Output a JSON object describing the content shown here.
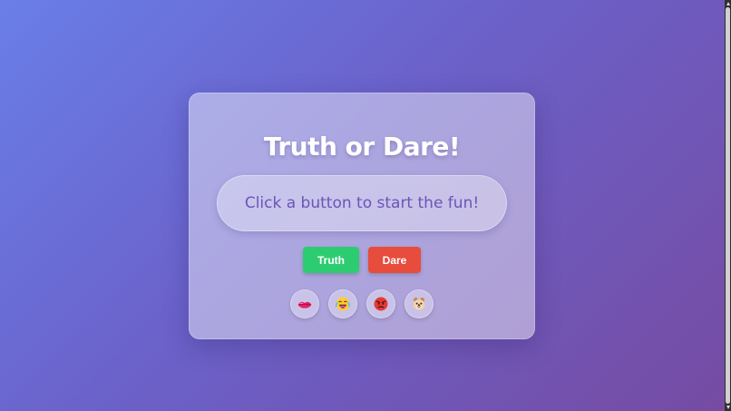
{
  "app": {
    "title": "Truth or Dare!",
    "message": "Click a button to start the fun!"
  },
  "actions": {
    "truth_label": "Truth",
    "dare_label": "Dare"
  },
  "emojis": [
    {
      "name": "lips-icon"
    },
    {
      "name": "laughing-face-icon"
    },
    {
      "name": "angry-face-icon"
    },
    {
      "name": "dog-face-icon"
    }
  ],
  "colors": {
    "background_start": "#6a7ee8",
    "background_end": "#764ba2",
    "truth_button": "#2ecc71",
    "dare_button": "#e74c3c",
    "title": "#ffffff",
    "message_text": "#6b55b7"
  }
}
